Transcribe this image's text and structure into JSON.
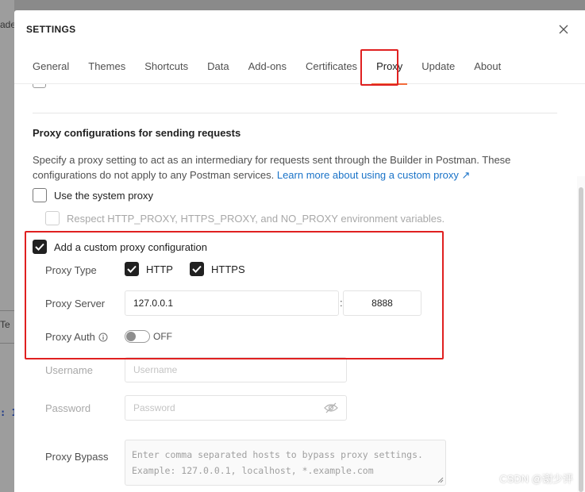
{
  "background": {
    "fragments": [
      "ade",
      "Te",
      "​:  1"
    ]
  },
  "modal": {
    "title": "SETTINGS",
    "tabs": [
      {
        "label": "General"
      },
      {
        "label": "Themes"
      },
      {
        "label": "Shortcuts"
      },
      {
        "label": "Data"
      },
      {
        "label": "Add-ons"
      },
      {
        "label": "Certificates"
      },
      {
        "label": "Proxy",
        "active": true
      },
      {
        "label": "Update"
      },
      {
        "label": "About"
      }
    ]
  },
  "proxy": {
    "section_title": "Proxy configurations for sending requests",
    "description": "Specify a proxy setting to act as an intermediary for requests sent through the Builder in Postman. These configurations do not apply to any Postman services. ",
    "learn_more_link": "Learn more about using a custom proxy ↗",
    "system_proxy": {
      "label": "Use the system proxy",
      "checked": false
    },
    "respect_env": {
      "label": "Respect HTTP_PROXY, HTTPS_PROXY, and NO_PROXY environment variables.",
      "checked": false,
      "disabled": true
    },
    "custom_proxy": {
      "label": "Add a custom proxy configuration",
      "checked": true
    },
    "proxy_type": {
      "label": "Proxy Type",
      "http_label": "HTTP",
      "http_checked": true,
      "https_label": "HTTPS",
      "https_checked": true
    },
    "proxy_server": {
      "label": "Proxy Server",
      "host": "127.0.0.1",
      "separator": ":",
      "port": "8888"
    },
    "proxy_auth": {
      "label": "Proxy Auth",
      "state": "OFF"
    },
    "username": {
      "label": "Username",
      "placeholder": "Username"
    },
    "password": {
      "label": "Password",
      "placeholder": "Password"
    },
    "bypass": {
      "label": "Proxy Bypass",
      "placeholder_line1": "Enter comma separated hosts to bypass proxy settings.",
      "placeholder_line2": "Example: 127.0.0.1, localhost, *.example.com"
    }
  },
  "watermark": "CSDN @谢少评",
  "colors": {
    "accent": "#f26b3a",
    "highlight": "#e02020",
    "link": "#1a73c8"
  }
}
